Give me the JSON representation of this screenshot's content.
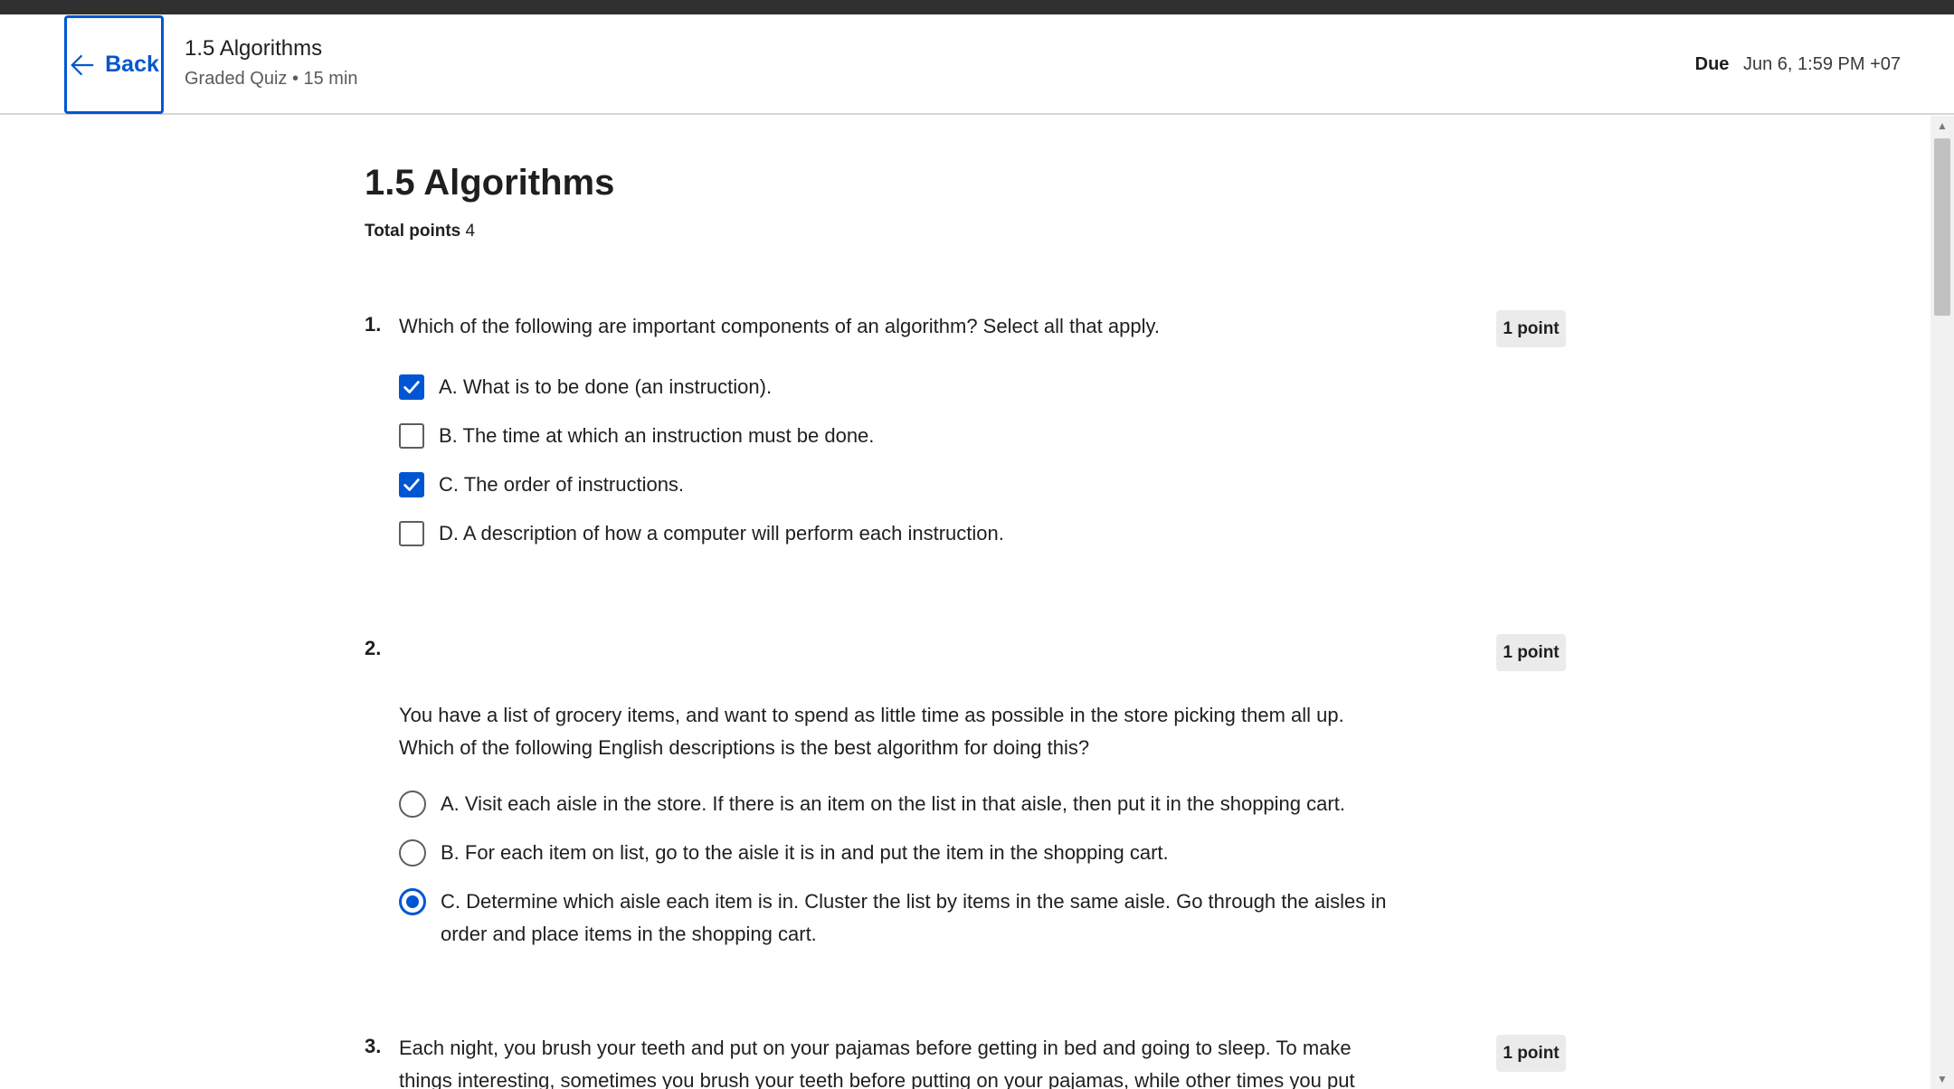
{
  "header": {
    "back_label": "Back",
    "title": "1.5 Algorithms",
    "subtitle": "Graded Quiz • 15 min",
    "due_label": "Due",
    "due_value": "Jun 6, 1:59 PM +07"
  },
  "main": {
    "title": "1.5 Algorithms",
    "total_points_label": "Total points",
    "total_points_value": "4"
  },
  "questions": [
    {
      "number": "1.",
      "text": "Which of the following are important components of an algorithm? Select all that apply.",
      "points": "1 point",
      "type": "checkbox",
      "options": [
        {
          "label": "A. What is to be done (an instruction).",
          "checked": true
        },
        {
          "label": "B. The time at which an instruction must be done.",
          "checked": false
        },
        {
          "label": "C. The order of instructions.",
          "checked": true
        },
        {
          "label": "D. A description of how a computer will perform each instruction.",
          "checked": false
        }
      ]
    },
    {
      "number": "2.",
      "text": "You have a list of grocery items, and want to spend as little time as possible in the store picking them all up. Which of the following English descriptions is the best algorithm for doing this?",
      "points": "1 point",
      "type": "radio",
      "options": [
        {
          "label": "A. Visit each aisle in the store. If there is an item on the list in that aisle, then put it in the shopping cart.",
          "checked": false
        },
        {
          "label": "B. For each item on list, go to the aisle it is in and put the item in the shopping cart.",
          "checked": false
        },
        {
          "label": "C. Determine which aisle each item is in. Cluster the list by items in the same aisle. Go through the aisles in order and place items in the shopping cart.",
          "checked": true
        }
      ]
    },
    {
      "number": "3.",
      "text": "Each night, you brush your teeth and put on your pajamas before getting in bed and going to sleep. To make things interesting, sometimes you brush your teeth before putting on your pajamas, while other times you put",
      "points": "1 point"
    }
  ],
  "colors": {
    "accent": "#0056d2",
    "topbar": "#303030",
    "badge_bg": "#ebebeb"
  },
  "icons": {
    "back": "arrow-left-icon",
    "check": "checkmark-icon"
  }
}
